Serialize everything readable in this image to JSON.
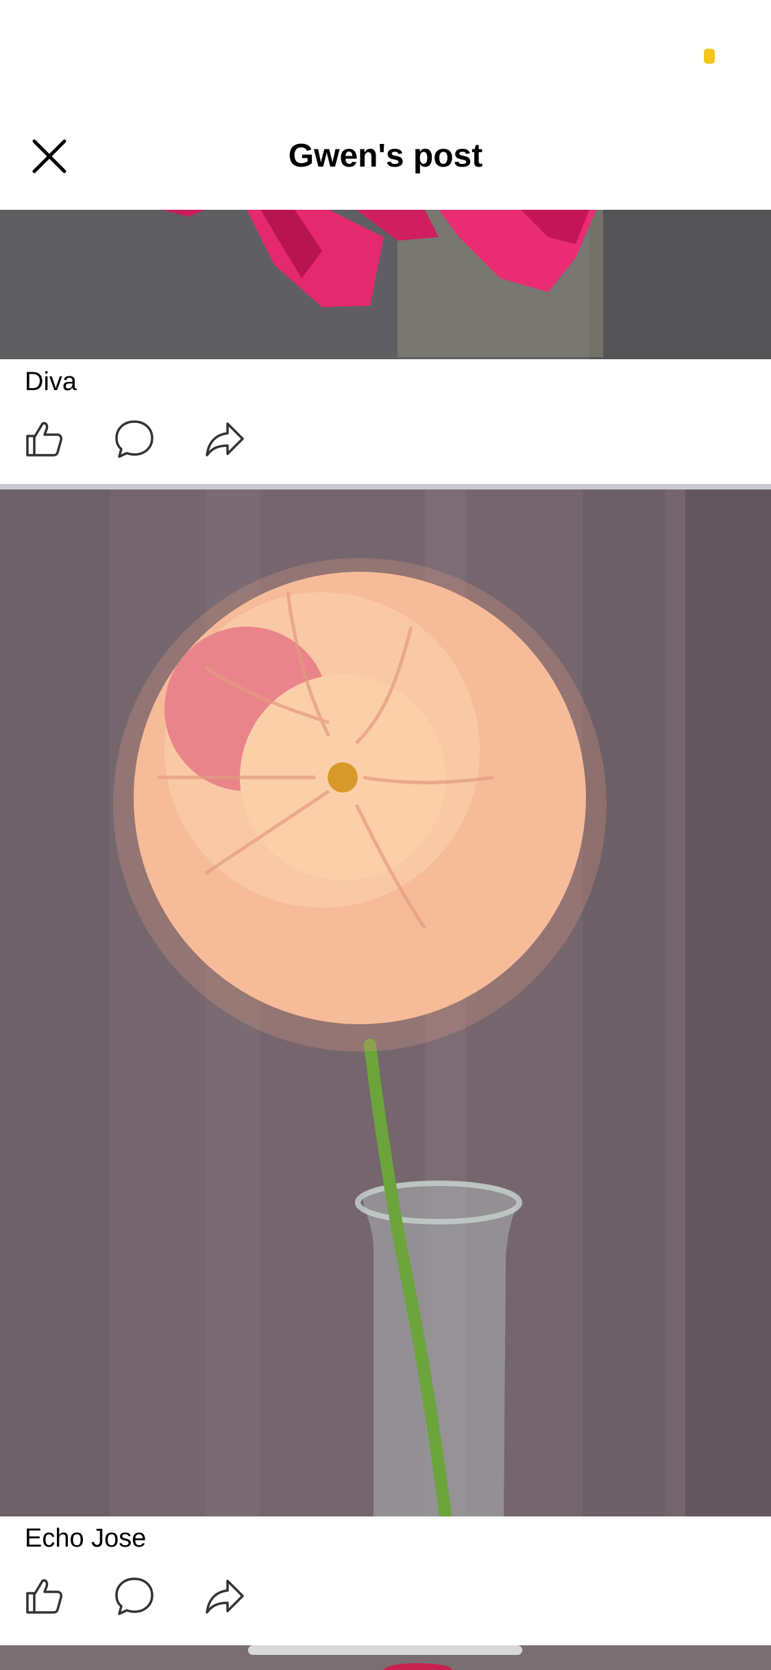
{
  "header": {
    "title": "Gwen's post"
  },
  "posts": [
    {
      "caption": "Diva"
    },
    {
      "caption": "Echo Jose"
    }
  ],
  "colors": {
    "status_dot": "#f4c61b",
    "icon_stroke": "#333333"
  },
  "icons": [
    "close-icon",
    "like-icon",
    "comment-icon",
    "share-icon"
  ]
}
